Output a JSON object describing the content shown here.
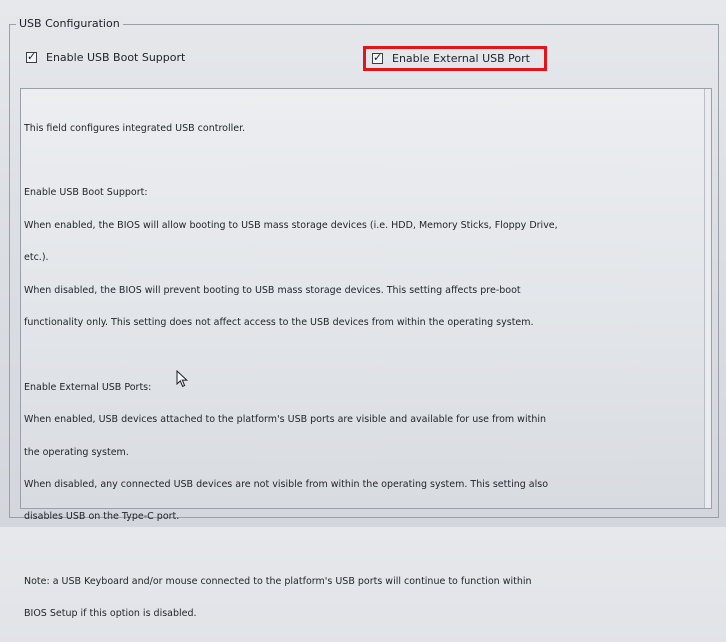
{
  "group": {
    "title": "USB Configuration"
  },
  "options": {
    "usb_boot_support": {
      "label": "Enable USB Boot Support",
      "checked": true
    },
    "external_usb_port": {
      "label": "Enable External USB Port",
      "checked": true,
      "highlight_color": "#e3141a"
    }
  },
  "help": {
    "intro": "This field configures integrated USB controller.",
    "boot_support": {
      "heading": "Enable USB Boot Support:",
      "enabled_lines": [
        "When enabled, the BIOS will allow booting to USB mass storage devices (i.e. HDD, Memory Sticks, Floppy Drive,",
        " etc.)."
      ],
      "disabled_lines": [
        "When disabled, the BIOS will prevent booting to USB mass storage devices. This setting affects pre-boot",
        "functionality only. This setting does not affect access to the USB devices from within the operating system."
      ]
    },
    "external_ports": {
      "heading": "Enable External USB Ports:",
      "enabled_lines": [
        "When enabled, USB devices attached to the platform's USB ports are visible and available for use from within",
        "the operating system."
      ],
      "disabled_lines": [
        "When disabled, any connected USB devices are not visible from within the operating system. This setting also",
        "disables USB on the Type-C port."
      ]
    },
    "note_lines": [
      "Note: a USB Keyboard and/or mouse connected to the platform's USB ports will continue to function within",
      "BIOS Setup if this option is disabled."
    ]
  },
  "checkmark_glyph": "✓",
  "cursor_icon": "arrow-pointer"
}
